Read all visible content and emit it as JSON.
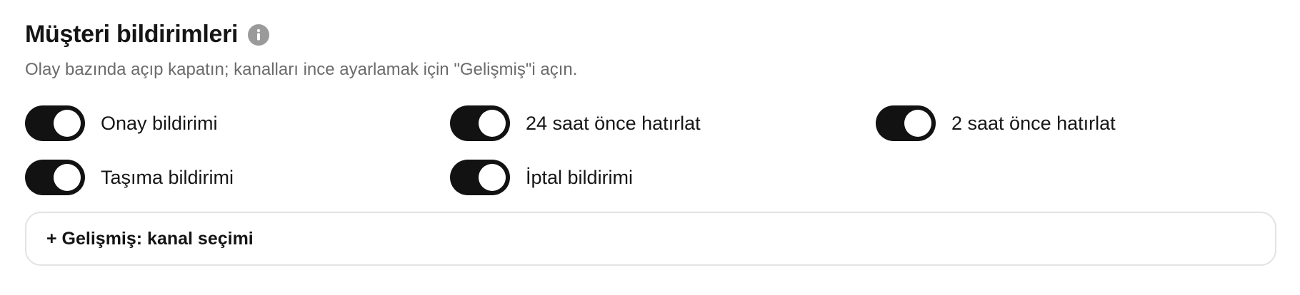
{
  "section": {
    "title": "Müşteri bildirimleri",
    "info_icon": "info-icon",
    "subtitle": "Olay bazında açıp kapatın; kanalları ince ayarlamak için \"Gelişmiş\"i açın."
  },
  "toggles": [
    {
      "label": "Onay bildirimi",
      "state": "on"
    },
    {
      "label": "24 saat önce hatırlat",
      "state": "on"
    },
    {
      "label": "2 saat önce hatırlat",
      "state": "on"
    },
    {
      "label": "Taşıma bildirimi",
      "state": "on"
    },
    {
      "label": "İptal bildirimi",
      "state": "on"
    }
  ],
  "advanced": {
    "label": "+ Gelişmiş: kanal seçimi"
  },
  "colors": {
    "switch_on": "#121212",
    "knob": "#ffffff",
    "subtitle_text": "#6b6b6b",
    "info_icon_bg": "#9a9a9a",
    "panel_border": "#e3e3e3"
  }
}
